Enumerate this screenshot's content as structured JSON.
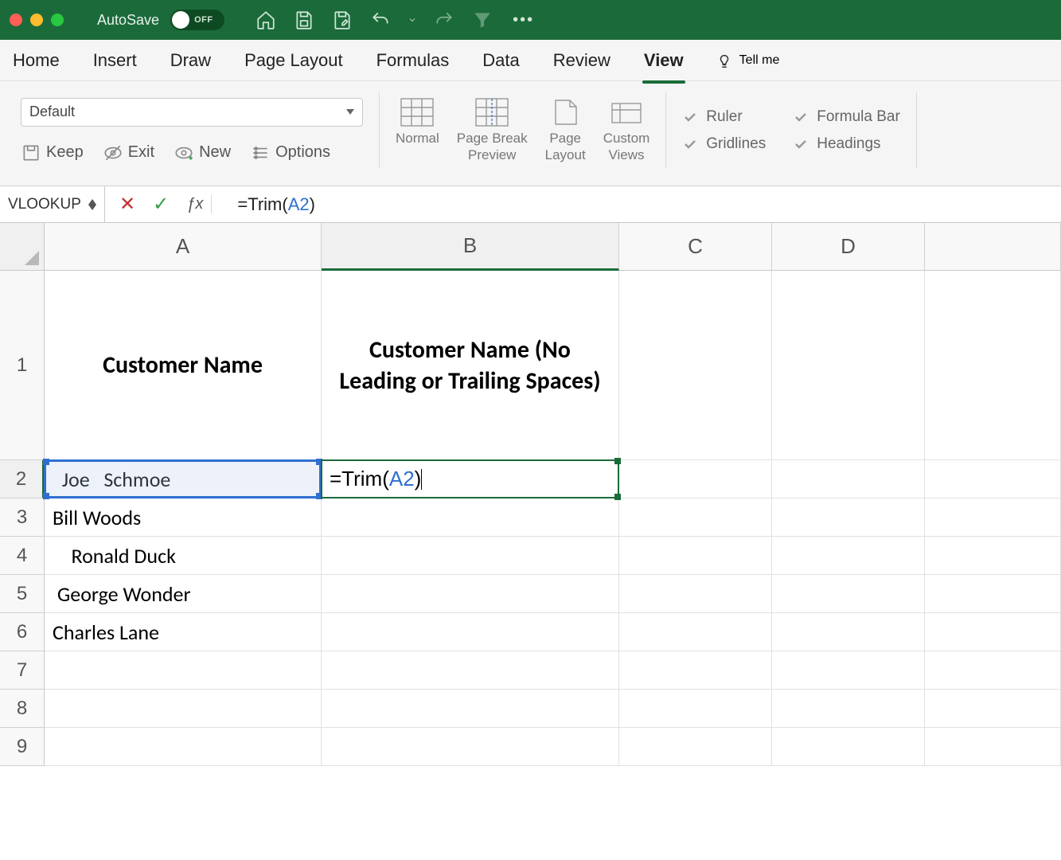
{
  "titlebar": {
    "autosave_label": "AutoSave",
    "autosave_state": "OFF"
  },
  "ribbon": {
    "tabs": [
      "Home",
      "Insert",
      "Draw",
      "Page Layout",
      "Formulas",
      "Data",
      "Review",
      "View"
    ],
    "active_tab": "View",
    "tell_me": "Tell me",
    "zoom_preset": "Default",
    "sheet_options": {
      "keep": "Keep",
      "exit": "Exit",
      "new": "New",
      "options": "Options"
    },
    "views": {
      "normal": "Normal",
      "page_break": "Page Break\nPreview",
      "page_layout": "Page\nLayout",
      "custom": "Custom\nViews"
    },
    "show": {
      "ruler": "Ruler",
      "formula_bar": "Formula Bar",
      "gridlines": "Gridlines",
      "headings": "Headings"
    }
  },
  "formula_bar": {
    "name_box": "VLOOKUP",
    "formula_prefix": "=Trim(",
    "formula_ref": "A2",
    "formula_suffix": ")"
  },
  "grid": {
    "columns": [
      "A",
      "B",
      "C",
      "D"
    ],
    "active_column": "B",
    "active_row": 2,
    "row_count": 9,
    "headers": {
      "A1": "Customer Name",
      "B1": "Customer Name (No Leading or Trailing Spaces)"
    },
    "data": {
      "A2": "  Joe   Schmoe  ",
      "A3": "Bill Woods",
      "A4": "    Ronald Duck",
      "A5": " George Wonder",
      "A6": "Charles Lane"
    },
    "editing": {
      "cell": "B2",
      "prefix": "=Trim(",
      "ref": "A2",
      "suffix": ")"
    }
  }
}
